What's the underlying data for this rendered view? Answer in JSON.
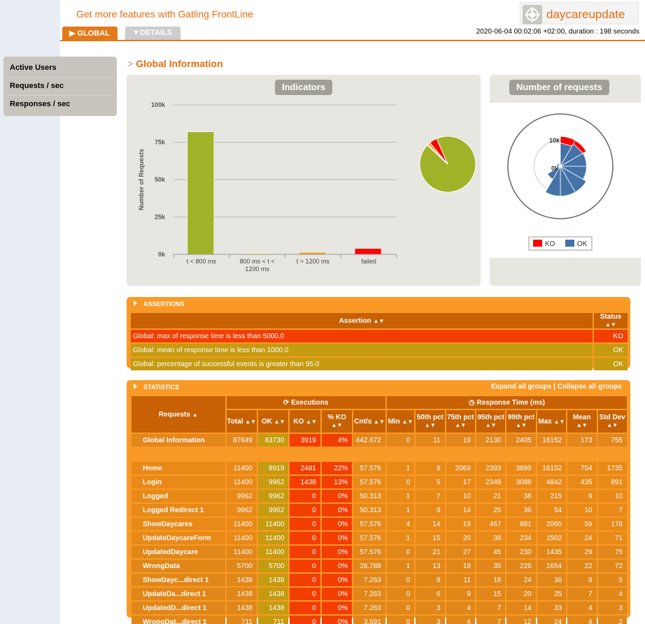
{
  "header": {
    "promo": "Get more features with Gatling FrontLine",
    "brand": "daycareupdate",
    "tabs": {
      "global": "GLOBAL",
      "details": "DETAILS"
    },
    "run_info": "2020-06-04 00:02:06 +02:00, duration : 198 seconds"
  },
  "sidebar": {
    "items": [
      "Active Users",
      "Requests / sec",
      "Responses / sec"
    ]
  },
  "section_title": "Global Information",
  "indicators": {
    "title": "Indicators",
    "chart_data": {
      "type": "bar",
      "ylabel": "Number of Requests",
      "ylim": [
        0,
        100000
      ],
      "yticks": [
        "0k",
        "25k",
        "50k",
        "75k",
        "100k"
      ],
      "categories": [
        "t < 800 ms",
        "800 ms < t < 1200 ms",
        "t > 1200 ms",
        "failed"
      ],
      "category_lines": [
        [
          "t < 800 ms"
        ],
        [
          "800 ms < t <",
          "1200 ms"
        ],
        [
          "t > 1200 ms"
        ],
        [
          "failed"
        ]
      ],
      "values": [
        81900,
        500,
        1300,
        3919
      ],
      "colors": [
        "#a0b228",
        "#ffdd00",
        "#ff9916",
        "#ff0000"
      ]
    },
    "pie": {
      "type": "pie",
      "values": [
        81900,
        500,
        1300,
        3919
      ],
      "colors": [
        "#a0b228",
        "#ffdd00",
        "#ff9916",
        "#ff0000"
      ]
    }
  },
  "number_of_requests": {
    "title": "Number of requests",
    "chart_data": {
      "type": "polar-stacked",
      "ticks": [
        "10k",
        "0k"
      ],
      "categories": [
        "Home",
        "Login",
        "Logged",
        "Logged Redirect 1",
        "ShowDaycares",
        "UpdateDaycareForm",
        "UpdatedDaycare",
        "WrongData",
        "ShowDayc...direct 1",
        "UpdateDa...direct 1",
        "UpdatedD...direct 1",
        "WrongDat...direct 1"
      ],
      "series": [
        {
          "name": "OK",
          "color": "#4572a7",
          "values": [
            8919,
            9962,
            9962,
            9962,
            11400,
            11400,
            11400,
            5700,
            1438,
            1438,
            1438,
            711
          ]
        },
        {
          "name": "KO",
          "color": "#ff0000",
          "values": [
            2481,
            1438,
            0,
            0,
            0,
            0,
            0,
            0,
            0,
            0,
            0,
            0
          ]
        }
      ],
      "legend": [
        "KO",
        "OK"
      ]
    }
  },
  "assertions": {
    "header": "ASSERTIONS",
    "columns": [
      "Assertion",
      "Status"
    ],
    "rows": [
      {
        "text": "Global: max of response time is less than 5000.0",
        "status": "KO"
      },
      {
        "text": "Global: mean of response time is less than 1000.0",
        "status": "OK"
      },
      {
        "text": "Global: percentage of successful events is greater than 95.0",
        "status": "OK"
      }
    ]
  },
  "statistics": {
    "header": "STATISTICS",
    "expand": "Expand all groups",
    "sep": " | ",
    "collapse": "Collapse all groups",
    "group_headers": {
      "requests": "Requests",
      "executions": "Executions",
      "response_time": "Response Time (ms)"
    },
    "columns": [
      "Total",
      "OK",
      "KO",
      "% KO",
      "Cnt/s",
      "Min",
      "50th pct",
      "75th pct",
      "95th pct",
      "99th pct",
      "Max",
      "Mean",
      "Std Dev"
    ],
    "global": [
      "Global Information",
      "87649",
      "83730",
      "3919",
      "4%",
      "442.672",
      "0",
      "11",
      "19",
      "2130",
      "2405",
      "16152",
      "173",
      "755"
    ],
    "rows": [
      [
        "Home",
        "11400",
        "8919",
        "2481",
        "22%",
        "57.576",
        "1",
        "9",
        "2069",
        "2393",
        "3899",
        "16152",
        "754",
        "1735"
      ],
      [
        "Login",
        "11400",
        "9962",
        "1438",
        "13%",
        "57.576",
        "0",
        "5",
        "17",
        "2349",
        "3088",
        "4842",
        "435",
        "891"
      ],
      [
        "Logged",
        "9962",
        "9962",
        "0",
        "0%",
        "50.313",
        "1",
        "7",
        "10",
        "21",
        "38",
        "215",
        "9",
        "10"
      ],
      [
        "Logged Redirect 1",
        "9962",
        "9962",
        "0",
        "0%",
        "50.313",
        "1",
        "9",
        "14",
        "25",
        "36",
        "54",
        "10",
        "7"
      ],
      [
        "ShowDaycares",
        "11400",
        "11400",
        "0",
        "0%",
        "57.576",
        "4",
        "14",
        "19",
        "467",
        "881",
        "2065",
        "59",
        "178"
      ],
      [
        "UpdateDaycareForm",
        "11400",
        "11400",
        "0",
        "0%",
        "57.576",
        "1",
        "15",
        "20",
        "38",
        "234",
        "1502",
        "24",
        "71"
      ],
      [
        "UpdatedDaycare",
        "11400",
        "11400",
        "0",
        "0%",
        "57.576",
        "0",
        "21",
        "27",
        "45",
        "230",
        "1435",
        "29",
        "75"
      ],
      [
        "WrongData",
        "5700",
        "5700",
        "0",
        "0%",
        "28.788",
        "1",
        "13",
        "18",
        "35",
        "226",
        "1654",
        "22",
        "72"
      ],
      [
        "ShowDayc...direct 1",
        "1438",
        "1438",
        "0",
        "0%",
        "7.263",
        "0",
        "8",
        "11",
        "18",
        "24",
        "36",
        "8",
        "5"
      ],
      [
        "UpdateDa...direct 1",
        "1438",
        "1438",
        "0",
        "0%",
        "7.263",
        "0",
        "6",
        "9",
        "15",
        "20",
        "25",
        "7",
        "4"
      ],
      [
        "UpdatedD...direct 1",
        "1438",
        "1438",
        "0",
        "0%",
        "7.263",
        "0",
        "3",
        "4",
        "7",
        "14",
        "33",
        "4",
        "3"
      ],
      [
        "WrongDat...direct 1",
        "711",
        "711",
        "0",
        "0%",
        "3.591",
        "0",
        "3",
        "4",
        "7",
        "12",
        "24",
        "4",
        "2"
      ]
    ]
  }
}
